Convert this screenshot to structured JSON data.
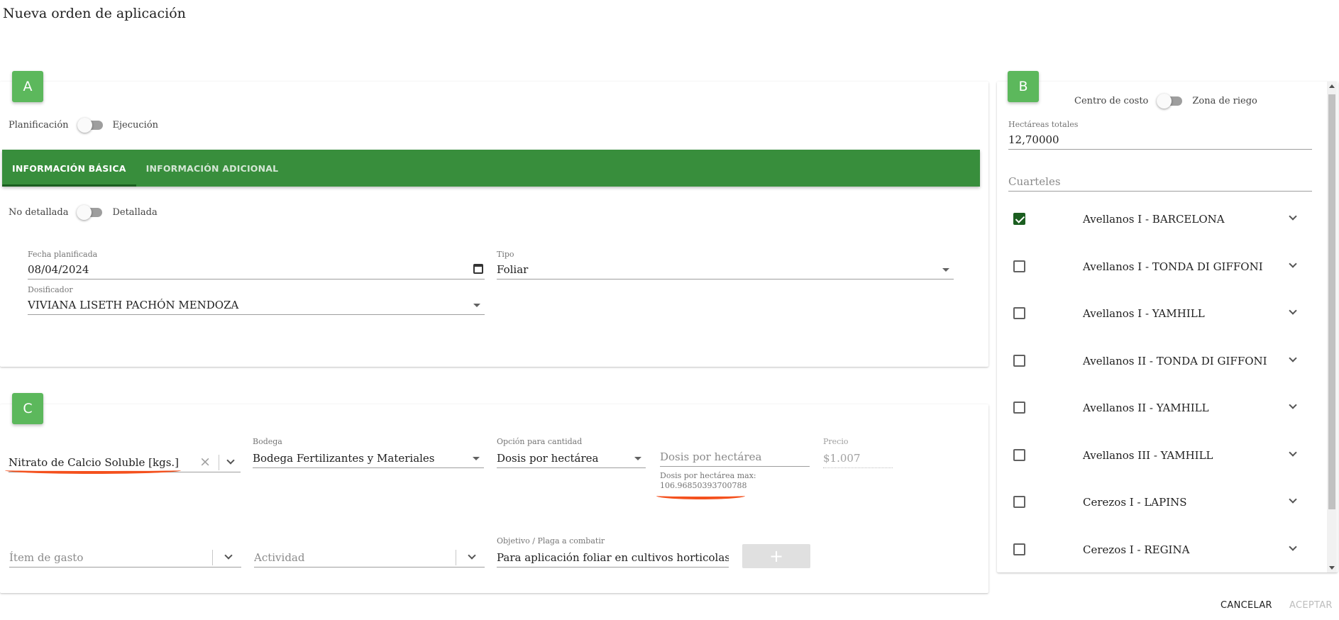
{
  "page": {
    "title": "Nueva orden de aplicación"
  },
  "section_a": {
    "badge": "A",
    "mode_toggle": {
      "left": "Planificación",
      "right": "Ejecución"
    },
    "tabs": [
      {
        "label": "INFORMACIÓN BÁSICA",
        "active": true
      },
      {
        "label": "INFORMACIÓN ADICIONAL",
        "active": false
      }
    ],
    "detail_toggle": {
      "left": "No detallada",
      "right": "Detallada"
    },
    "fecha": {
      "label": "Fecha planificada",
      "value": "08/04/2024"
    },
    "tipo": {
      "label": "Tipo",
      "value": "Foliar"
    },
    "dosificador": {
      "label": "Dosificador",
      "value": "VIVIANA LISETH PACHÓN MENDOZA"
    }
  },
  "section_b": {
    "badge": "B",
    "toggle": {
      "left": "Centro de costo",
      "right": "Zona de riego"
    },
    "hectareas": {
      "label": "Hectáreas totales",
      "value": "12,70000"
    },
    "cuarteles_placeholder": "Cuarteles",
    "items": [
      {
        "label": "Avellanos I - BARCELONA",
        "checked": true
      },
      {
        "label": "Avellanos I - TONDA DI GIFFONI",
        "checked": false
      },
      {
        "label": "Avellanos I - YAMHILL",
        "checked": false
      },
      {
        "label": "Avellanos II - TONDA DI GIFFONI",
        "checked": false
      },
      {
        "label": "Avellanos II - YAMHILL",
        "checked": false
      },
      {
        "label": "Avellanos III - YAMHILL",
        "checked": false
      },
      {
        "label": "Cerezos I - LAPINS",
        "checked": false
      },
      {
        "label": "Cerezos I - REGINA",
        "checked": false
      }
    ]
  },
  "section_c": {
    "badge": "C",
    "producto": {
      "value": "Nitrato de Calcio Soluble [kgs.]",
      "clear_glyph": "×"
    },
    "bodega": {
      "label": "Bodega",
      "value": "Bodega Fertilizantes y Materiales"
    },
    "opcion": {
      "label": "Opción para cantidad",
      "value": "Dosis por hectárea"
    },
    "dosis": {
      "placeholder": "Dosis por hectárea",
      "hint_label": "Dosis por hectárea max:",
      "hint_value": "106.96850393700788"
    },
    "precio": {
      "label": "Precio",
      "value": "$1.007"
    },
    "item_gasto": {
      "placeholder": "Ítem de gasto"
    },
    "actividad": {
      "placeholder": "Actividad"
    },
    "objetivo": {
      "label": "Objetivo / Plaga a combatir",
      "value": "Para aplicación foliar en cultivos horticolas y a"
    },
    "add_glyph": "+"
  },
  "footer": {
    "cancel": "CANCELAR",
    "accept": "ACEPTAR"
  },
  "colors": {
    "primary": "#388e3c",
    "badge": "#5cb85c",
    "accent_mark": "#f4511e"
  }
}
